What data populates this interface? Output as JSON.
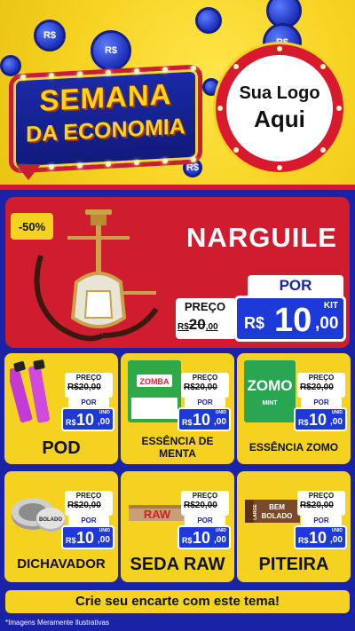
{
  "header": {
    "banner_line1": "SEMANA",
    "banner_line2": "DA ECONOMIA",
    "coin_label": "R$",
    "logo_line1": "Sua Logo",
    "logo_line2": "Aqui"
  },
  "featured": {
    "discount": "-50%",
    "name": "NARGUILE",
    "old_label": "PREÇO",
    "old_currency": "R$",
    "old_int": "20",
    "old_dec": ",00",
    "new_label": "POR",
    "new_currency": "R$",
    "new_int": "10",
    "new_dec": ",00",
    "unit": "KIT"
  },
  "products": [
    {
      "name": "POD",
      "old_label": "PREÇO",
      "old_price": "R$20,00",
      "new_label": "POR",
      "currency": "R$",
      "int": "10",
      "dec": ",00",
      "unit": "UNID"
    },
    {
      "name": "ESSÊNCIA DE MENTA",
      "old_label": "PREÇO",
      "old_price": "R$20,00",
      "new_label": "POR",
      "currency": "R$",
      "int": "10",
      "dec": ",00",
      "unit": "UNID"
    },
    {
      "name": "ESSÊNCIA ZOMO",
      "old_label": "PREÇO",
      "old_price": "R$20,00",
      "new_label": "POR",
      "currency": "R$",
      "int": "10",
      "dec": ",00",
      "unit": "UNID"
    },
    {
      "name": "DICHAVADOR",
      "old_label": "PREÇO",
      "old_price": "R$20,00",
      "new_label": "POR",
      "currency": "R$",
      "int": "10",
      "dec": ",00",
      "unit": "UNID"
    },
    {
      "name": "SEDA RAW",
      "old_label": "PREÇO",
      "old_price": "R$20,00",
      "new_label": "POR",
      "currency": "R$",
      "int": "10",
      "dec": ",00",
      "unit": "UNID"
    },
    {
      "name": "PITEIRA",
      "old_label": "PREÇO",
      "old_price": "R$20,00",
      "new_label": "POR",
      "currency": "R$",
      "int": "10",
      "dec": ",00",
      "unit": "UNID"
    }
  ],
  "product_art": {
    "zomba_label": "ZOMBA",
    "zomo_label": "ZOMO",
    "zomo_sub": "MINT",
    "raw_label": "RAW",
    "piteira_side": "LARGE",
    "piteira_label1": "BEM",
    "piteira_label2": "BOLADO",
    "dichavador_label": "BOLADO"
  },
  "footer": {
    "cta": "Crie seu encarte com este tema!",
    "disclaimer": "*Imagens Meramente Ilustrativas"
  },
  "colors": {
    "yellow": "#f5d21f",
    "blue": "#1a23a8",
    "red": "#cf1d2f",
    "price_blue": "#1d3ad9"
  }
}
